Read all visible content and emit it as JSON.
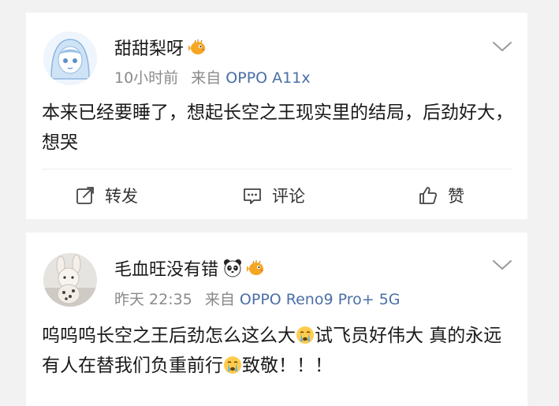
{
  "posts": [
    {
      "username": "甜甜梨呀",
      "time": "10小时前",
      "source_prefix": "来自",
      "device": "OPPO A11x",
      "text": "本来已经要睡了，想起长空之王现实里的结局，后劲好大，想哭",
      "actions": {
        "repost": "转发",
        "comment": "评论",
        "like": "赞"
      }
    },
    {
      "username": "毛血旺没有错",
      "time": "昨天 22:35",
      "source_prefix": "来自",
      "device": "OPPO Reno9 Pro+ 5G",
      "text_part1": "呜呜呜长空之王后劲怎么这么大",
      "text_part2": "试飞员好伟大 真的永远有人在替我们负重前行",
      "text_part3": "致敬！！！"
    }
  ],
  "icons": {
    "badge": "pufferfish-badge-icon",
    "panda": "panda-badge-icon",
    "crying": "crying-emoji-icon",
    "menu": "chevron-down-icon",
    "repost": "repost-icon",
    "comment": "comment-icon",
    "like": "thumbs-up-icon"
  },
  "colors": {
    "device_link": "#4a6fa5",
    "badge_orange": "#f5a623"
  }
}
